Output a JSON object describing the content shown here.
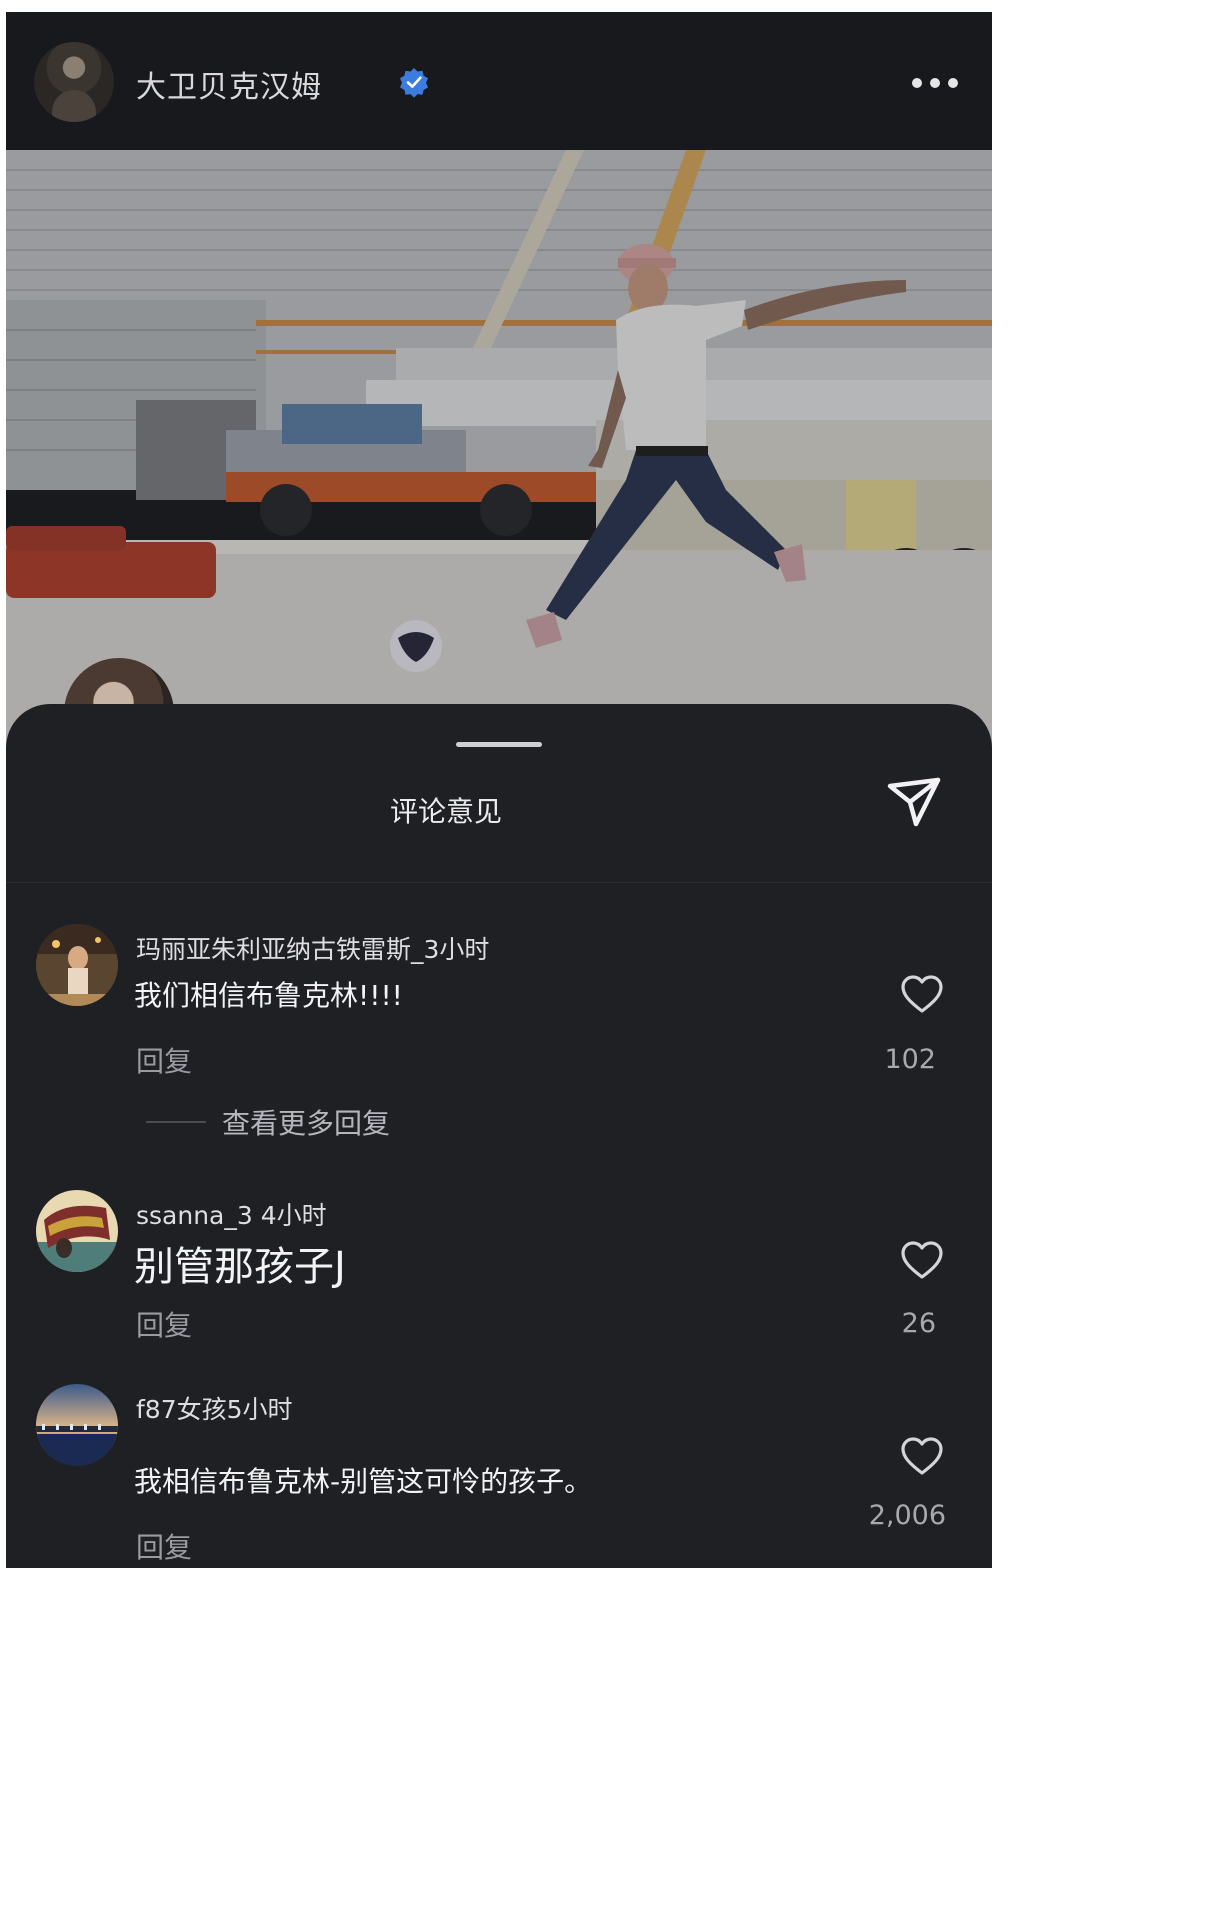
{
  "post": {
    "author": "大卫贝克汉姆",
    "verified": true,
    "more_icon": "more-horizontal-icon"
  },
  "sheet": {
    "title": "评论意见",
    "share_icon": "paper-plane-icon"
  },
  "comments": [
    {
      "meta": "玛丽亚朱利亚纳古铁雷斯_3小时",
      "text": "我们相信布鲁克林!!!!",
      "reply_label": "回复",
      "likes": "102",
      "view_more": "查看更多回复"
    },
    {
      "meta": "ssanna_3 4小时",
      "text": "别管那孩子J",
      "reply_label": "回复",
      "likes": "26"
    },
    {
      "meta": "f87女孩5小时",
      "text": "我相信布鲁克林-别管这可怜的孩子。",
      "reply_label": "回复",
      "likes": "2,006"
    }
  ],
  "colors": {
    "background": "#1c1d21",
    "sheet": "#1f2024",
    "verified_badge": "#3b7ddd"
  }
}
